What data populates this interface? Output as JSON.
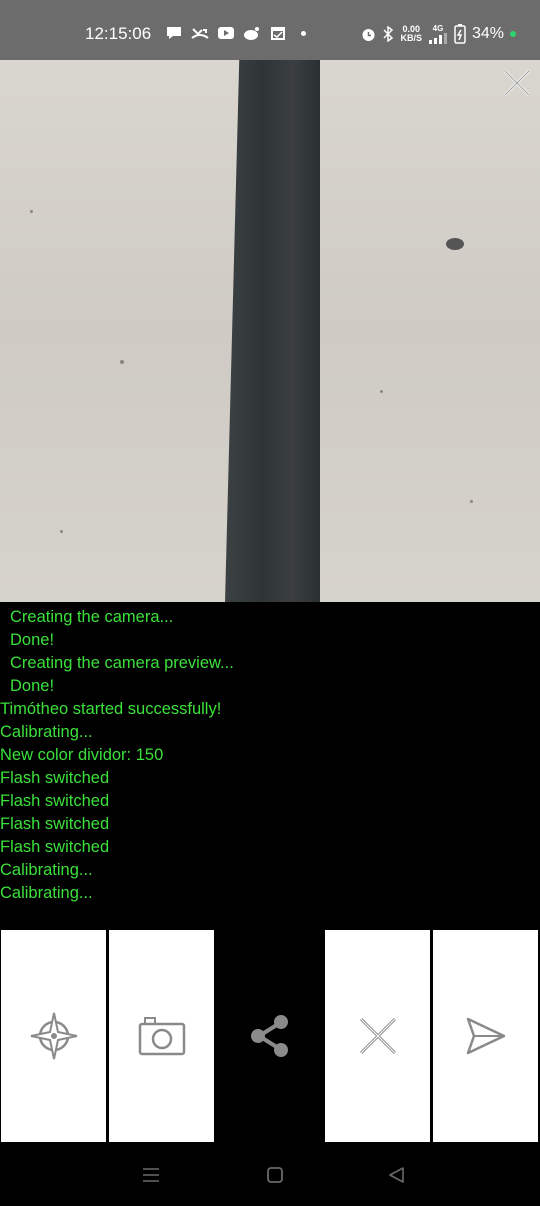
{
  "status_bar": {
    "time": "12:15:06",
    "net_speed_value": "0.00",
    "net_speed_unit": "KB/S",
    "network": "4G",
    "battery": "34%"
  },
  "log": {
    "lines": [
      {
        "text": "Creating the camera...",
        "indent": true
      },
      {
        "text": "Done!",
        "indent": true
      },
      {
        "text": "Creating the camera preview...",
        "indent": true
      },
      {
        "text": "Done!",
        "indent": true
      },
      {
        "text": "Timótheo started successfully!",
        "indent": false
      },
      {
        "text": "Calibrating...",
        "indent": false
      },
      {
        "text": "New color dividor: 150",
        "indent": false
      },
      {
        "text": "Flash switched",
        "indent": false
      },
      {
        "text": "Flash switched",
        "indent": false
      },
      {
        "text": "Flash switched",
        "indent": false
      },
      {
        "text": "Flash switched",
        "indent": false
      },
      {
        "text": "Calibrating...",
        "indent": false
      },
      {
        "text": "Calibrating...",
        "indent": false
      }
    ]
  },
  "buttons": [
    {
      "name": "calibrate-button",
      "icon": "compass-target-icon"
    },
    {
      "name": "camera-button",
      "icon": "camera-icon"
    },
    {
      "name": "share-button",
      "icon": "share-icon"
    },
    {
      "name": "cancel-button",
      "icon": "close-icon"
    },
    {
      "name": "send-button",
      "icon": "send-icon"
    }
  ],
  "colors": {
    "log_text": "#3be13b",
    "status_bar_bg": "#6c6c6c",
    "icon_gray": "#8a8a8a"
  }
}
